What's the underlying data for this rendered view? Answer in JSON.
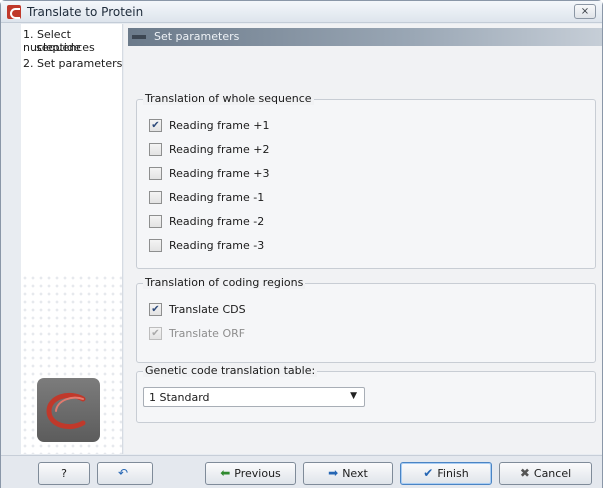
{
  "window": {
    "title": "Translate to Protein",
    "close_label": "⨯"
  },
  "steps": [
    {
      "label": "1. Select nucleotide"
    },
    {
      "label": "sequences"
    },
    {
      "label": "2. Set parameters"
    }
  ],
  "section_header": "Set parameters",
  "whole_sequence": {
    "label": "Translation of whole sequence",
    "frames": [
      {
        "label": "Reading frame +1",
        "mark": "✔"
      },
      {
        "label": "Reading frame +2",
        "mark": ""
      },
      {
        "label": "Reading frame +3",
        "mark": ""
      },
      {
        "label": "Reading frame -1",
        "mark": ""
      },
      {
        "label": "Reading frame -2",
        "mark": ""
      },
      {
        "label": "Reading frame -3",
        "mark": ""
      }
    ]
  },
  "coding_regions": {
    "label": "Translation of coding regions",
    "cds_label": "Translate CDS",
    "cds_mark": "✔",
    "orf_label": "Translate ORF",
    "orf_mark": "✔"
  },
  "genetic_code": {
    "label": "Genetic code translation table:",
    "selected": "1 Standard",
    "arrow": "▼"
  },
  "buttons": {
    "help": "?",
    "reset_icon": "↶",
    "previous": "Previous",
    "previous_icon": "⬅",
    "next": "Next",
    "next_icon": "➡",
    "finish": "Finish",
    "finish_icon": "✔",
    "cancel": "Cancel",
    "cancel_icon": "✖"
  },
  "colors": {
    "accent": "#4a84c4",
    "logo": "#c0392b"
  }
}
